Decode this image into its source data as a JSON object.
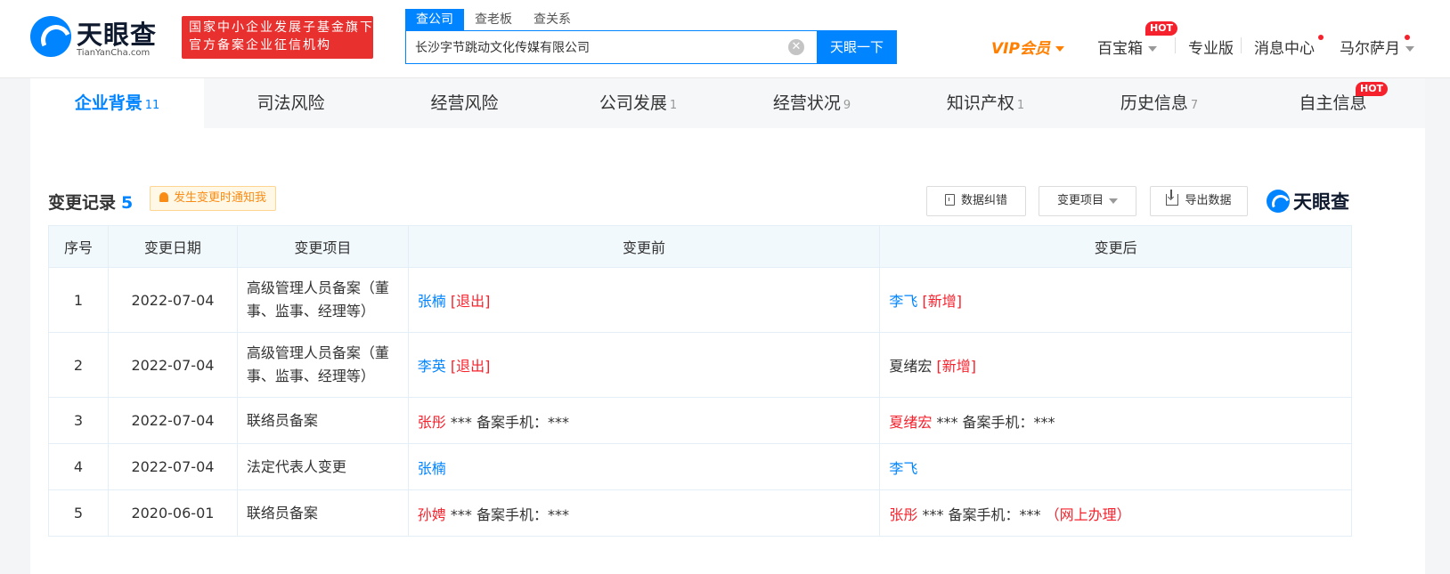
{
  "header": {
    "logo_cn": "天眼查",
    "logo_en": "TianYanCha.com",
    "badge_line1": "国家中小企业发展子基金旗下",
    "badge_line2": "官方备案企业征信机构",
    "search_tabs": [
      "查公司",
      "查老板",
      "查关系"
    ],
    "search_value": "长沙字节跳动文化传媒有限公司",
    "clear_glyph": "✕",
    "search_button": "天眼一下",
    "vip": "VIP会员",
    "baobox": "百宝箱",
    "hot": "HOT",
    "pro": "专业版",
    "messages": "消息中心",
    "user": "马尔萨月"
  },
  "tabs": [
    {
      "label": "企业背景",
      "count": "11"
    },
    {
      "label": "司法风险",
      "count": ""
    },
    {
      "label": "经营风险",
      "count": ""
    },
    {
      "label": "公司发展",
      "count": "1"
    },
    {
      "label": "经营状况",
      "count": "9"
    },
    {
      "label": "知识产权",
      "count": "1"
    },
    {
      "label": "历史信息",
      "count": "7"
    },
    {
      "label": "自主信息",
      "count": "",
      "hot": "HOT"
    }
  ],
  "section": {
    "title": "变更记录",
    "count": "5",
    "notify": "发生变更时通知我",
    "btn_correct": "数据纠错",
    "btn_filter": "变更项目",
    "btn_export": "导出数据",
    "brand": "天眼查"
  },
  "table": {
    "headers": [
      "序号",
      "变更日期",
      "变更项目",
      "变更前",
      "变更后"
    ],
    "rows": [
      {
        "no": "1",
        "date": "2022-07-04",
        "item": "高级管理人员备案（董事、监事、经理等）",
        "before_name": "张楠",
        "before_tag": "[退出]",
        "before_rest": "",
        "after_name": "李飞",
        "after_tag": "[新增]",
        "after_rest": "",
        "after_note": ""
      },
      {
        "no": "2",
        "date": "2022-07-04",
        "item": "高级管理人员备案（董事、监事、经理等）",
        "before_name": "李英",
        "before_tag": "[退出]",
        "before_rest": "",
        "after_name": "夏绪宏",
        "after_tag": "[新增]",
        "after_rest": "",
        "after_note": ""
      },
      {
        "no": "3",
        "date": "2022-07-04",
        "item": "联络员备案",
        "before_name": "张彤",
        "before_tag": "",
        "before_rest": " *** 备案手机：***",
        "after_name": "夏绪宏",
        "after_tag": "",
        "after_rest": " *** 备案手机：***",
        "after_note": ""
      },
      {
        "no": "4",
        "date": "2022-07-04",
        "item": "法定代表人变更",
        "before_name": "张楠",
        "before_tag": "",
        "before_rest": "",
        "after_name": "李飞",
        "after_tag": "",
        "after_rest": "",
        "after_note": ""
      },
      {
        "no": "5",
        "date": "2020-06-01",
        "item": "联络员备案",
        "before_name": "孙娉",
        "before_tag": "",
        "before_rest": " *** 备案手机：***",
        "after_name": "张彤",
        "after_tag": "",
        "after_rest": " *** 备案手机：***",
        "after_note": "（网上办理）"
      }
    ]
  },
  "colors": {
    "accent": "#0084ff",
    "red": "#f5222d",
    "vip": "#ff7f00"
  }
}
